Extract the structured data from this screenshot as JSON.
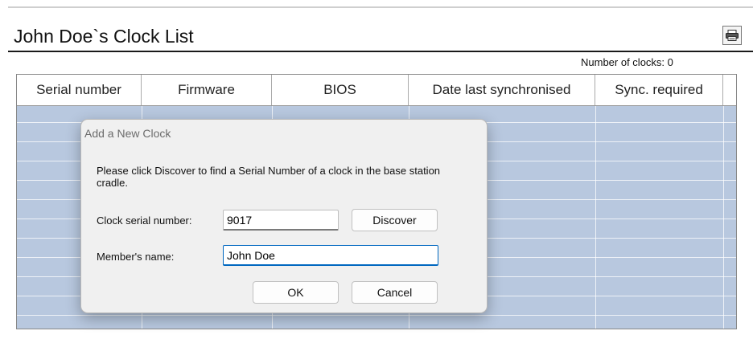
{
  "page": {
    "title": "John Doe`s Clock List",
    "clock_count": "Number of clocks: 0"
  },
  "toolbar": {
    "icon": "printer-icon"
  },
  "grid": {
    "columns": [
      "Serial number",
      "Firmware",
      "BIOS",
      "Date last synchronised",
      "Sync. required"
    ],
    "rows": []
  },
  "dialog": {
    "title": "Add a New Clock",
    "message": "Please click Discover to find a Serial Number of a clock in the base station cradle.",
    "serial_label": "Clock serial number:",
    "serial_value": "9017",
    "discover_label": "Discover",
    "member_label": "Member's name:",
    "member_value": "John Doe",
    "ok_label": "OK",
    "cancel_label": "Cancel"
  },
  "colors": {
    "grid_background": "#b8c8df",
    "focus_accent": "#0067c0"
  }
}
